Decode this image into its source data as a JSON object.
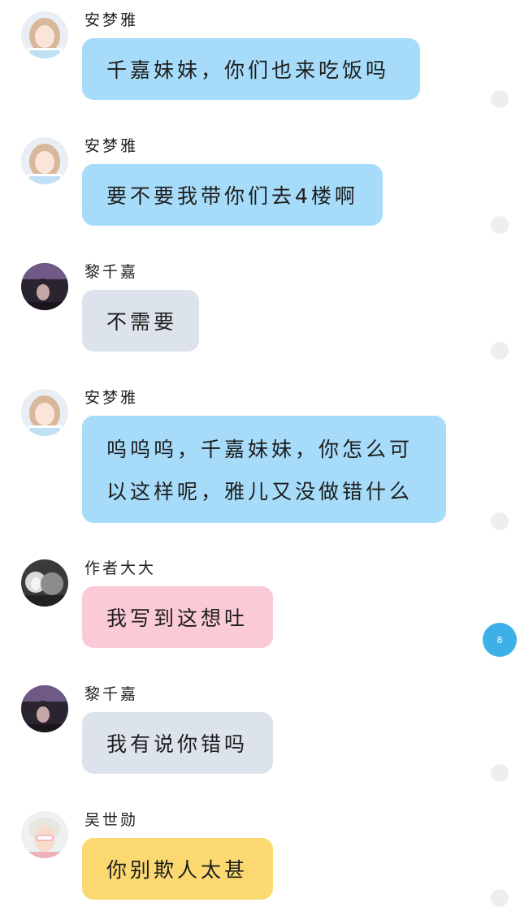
{
  "messages": [
    {
      "sender": "安梦雅",
      "text": "千嘉妹妹，你们也来吃饭吗",
      "bubble_color": "#a6dcf9",
      "avatar_icon": "girl-light-avatar"
    },
    {
      "sender": "安梦雅",
      "text": "要不要我带你们去4楼啊",
      "bubble_color": "#a6dcf9",
      "avatar_icon": "girl-light-avatar"
    },
    {
      "sender": "黎千嘉",
      "text": "不需要",
      "bubble_color": "#dde3ec",
      "avatar_icon": "girl-dark-avatar"
    },
    {
      "sender": "安梦雅",
      "text_lines": [
        "呜呜呜，千嘉妹妹，你怎么可",
        "以这样呢，雅儿又没做错什么"
      ],
      "bubble_color": "#a6dcf9",
      "avatar_icon": "girl-light-avatar"
    },
    {
      "sender": "作者大大",
      "text": "我写到这想吐",
      "bubble_color": "#fbcad7",
      "avatar_icon": "author-avatar"
    },
    {
      "sender": "黎千嘉",
      "text": "我有说你错吗",
      "bubble_color": "#dde3ec",
      "avatar_icon": "girl-dark-avatar"
    },
    {
      "sender": "吴世勋",
      "text": "你别欺人太甚",
      "bubble_color": "#fbd970",
      "avatar_icon": "boy-avatar"
    }
  ],
  "unread_badge": "8"
}
